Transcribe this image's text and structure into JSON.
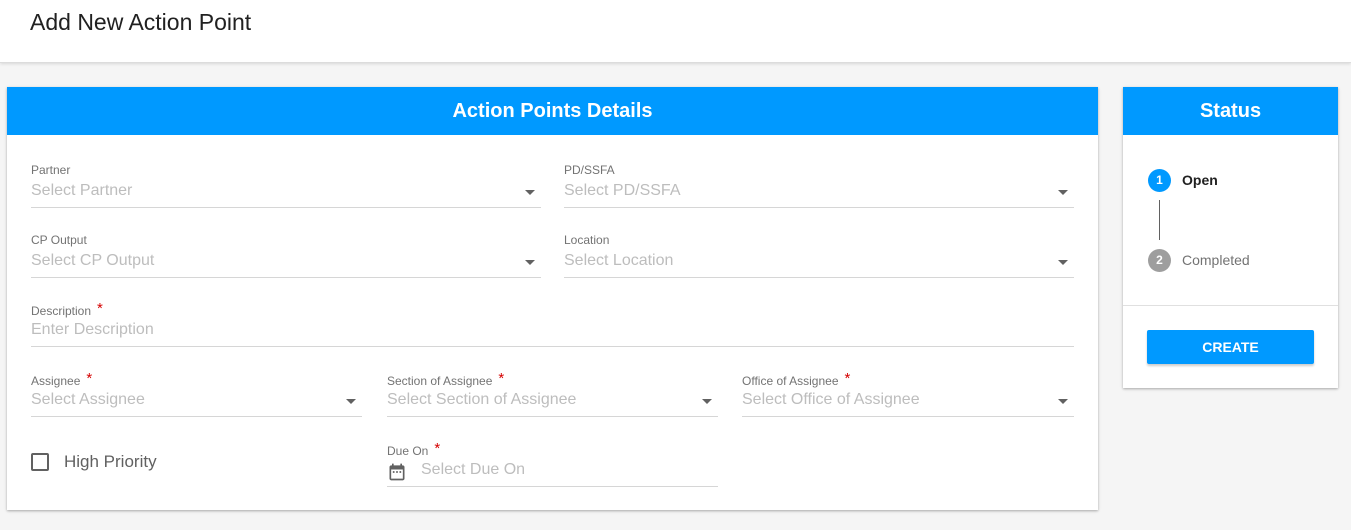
{
  "header": {
    "title": "Add New Action Point"
  },
  "details": {
    "title": "Action Points Details",
    "partner": {
      "label": "Partner",
      "placeholder": "Select Partner"
    },
    "pd_ssfa": {
      "label": "PD/SSFA",
      "placeholder": "Select PD/SSFA"
    },
    "cp_output": {
      "label": "CP Output",
      "placeholder": "Select CP Output"
    },
    "location": {
      "label": "Location",
      "placeholder": "Select Location"
    },
    "description": {
      "label": "Description",
      "placeholder": "Enter Description",
      "required": "*"
    },
    "assignee": {
      "label": "Assignee",
      "placeholder": "Select Assignee",
      "required": "*"
    },
    "section": {
      "label": "Section of Assignee",
      "placeholder": "Select Section of Assignee",
      "required": "*"
    },
    "office": {
      "label": "Office of Assignee",
      "placeholder": "Select Office of Assignee",
      "required": "*"
    },
    "high_priority": {
      "label": "High Priority",
      "checked": false
    },
    "due_on": {
      "label": "Due On",
      "placeholder": "Select Due On",
      "required": "*"
    }
  },
  "status": {
    "title": "Status",
    "steps": [
      {
        "number": "1",
        "label": "Open",
        "active": true
      },
      {
        "number": "2",
        "label": "Completed",
        "active": false
      }
    ],
    "create_label": "CREATE"
  },
  "colors": {
    "accent": "#0099ff",
    "required": "#d50000",
    "inactive_step": "#9e9e9e"
  }
}
